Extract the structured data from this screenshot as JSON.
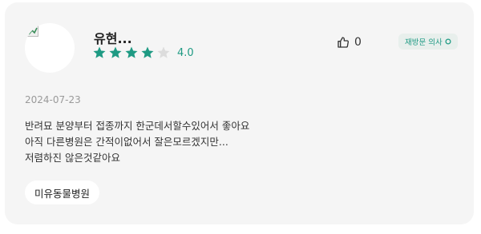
{
  "review": {
    "author_name": "유현...",
    "rating": 4.0,
    "rating_label": "4.0",
    "rating_max": 5,
    "like_count": "0",
    "badge_label": "재방문 의사",
    "date": "2024-07-23",
    "lines": [
      "반려묘 분양부터 접종까지 한군데서할수있어서 좋아요",
      "아직 다른병원은 간적이없어서 잘은모르겠지만...",
      "저렴하진 않은것같아요"
    ],
    "hospital_name": "미유동물병원"
  },
  "colors": {
    "accent": "#1e9a83",
    "star_empty": "#dcdcdc",
    "card_bg": "#f5f5f5"
  },
  "icons": {
    "like": "thumbs-up-icon",
    "badge": "circle-icon",
    "star": "star-icon",
    "avatar": "broken-image-icon"
  }
}
